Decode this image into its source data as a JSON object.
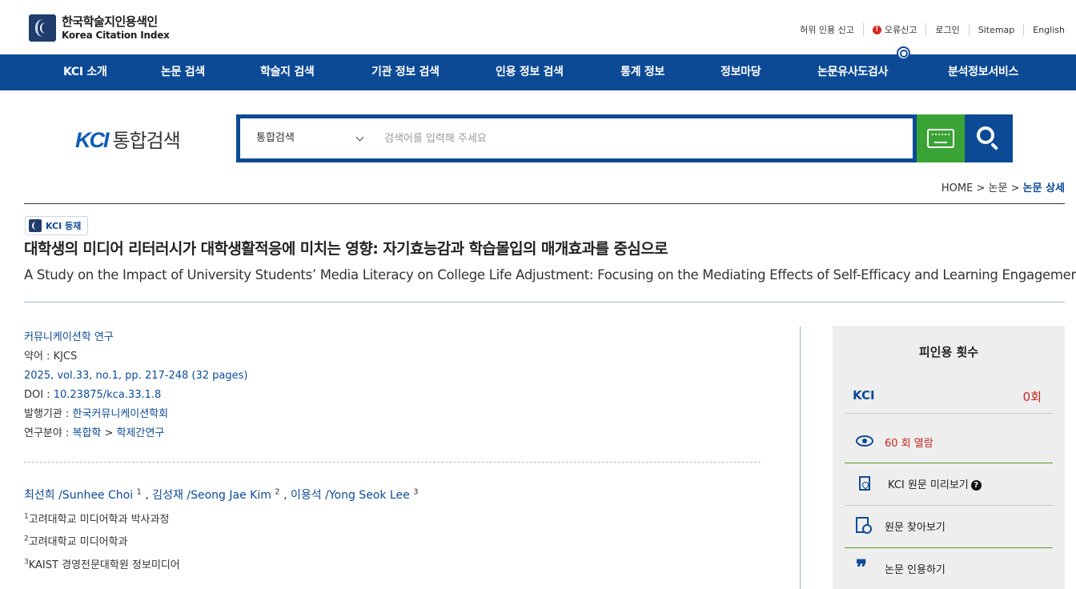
{
  "header": {
    "logo_ko": "한국학술지인용색인",
    "logo_en": "Korea Citation Index",
    "util_links": [
      "허위 인용 신고",
      "오류신고",
      "로그인",
      "Sitemap",
      "English"
    ]
  },
  "nav": {
    "items": [
      "KCI 소개",
      "논문 검색",
      "학술지 검색",
      "기관 정보 검색",
      "인용 정보 검색",
      "통계 정보",
      "정보마당",
      "논문유사도검사",
      "분석정보서비스"
    ]
  },
  "search": {
    "brand_logo": "KCI",
    "brand_text": "통합검색",
    "select_value": "통합검색",
    "placeholder": "검색어를 입력해 주세요"
  },
  "breadcrumb": {
    "home": "HOME",
    "sep1": " > ",
    "level1": "논문",
    "sep2": " > ",
    "current": "논문 상세"
  },
  "article": {
    "badge": "KCI 등재",
    "title_ko": "대학생의 미디어 리터러시가 대학생활적응에 미치는 영향: 자기효능감과 학습몰입의 매개효과를 중심으로",
    "title_en": "A Study on the Impact of University Students’ Media Literacy on College Life Adjustment: Focusing on the Mediating Effects of Self-Efficacy and Learning Engagement",
    "journal": "커뮤니케이션학 연구",
    "abbr_label": "약어 : ",
    "abbr": "KJCS",
    "volume": "2025, vol.33, no.1, pp. 217-248 (32 pages)",
    "doi_label": "DOI : ",
    "doi": "10.23875/kca.33.1.8",
    "publisher_label": "발행기관 : ",
    "publisher": "한국커뮤니케이션학회",
    "field_label": "연구분야 : ",
    "field1": "복합학",
    "field_sep": " > ",
    "field2": "학제간연구",
    "authors": [
      {
        "name": "최선희 /Sunhee Choi",
        "sup": "1"
      },
      {
        "name": "김성재 /Seong Jae Kim",
        "sup": "2"
      },
      {
        "name": "이용석 /Yong Seok Lee",
        "sup": "3"
      }
    ],
    "affiliations": [
      {
        "sup": "1",
        "text": "고려대학교 미디어학과 박사과정"
      },
      {
        "sup": "2",
        "text": "고려대학교 미디어학과"
      },
      {
        "sup": "3",
        "text": "KAIST 경영전문대학원 정보미디어"
      }
    ]
  },
  "side": {
    "title": "피인용 횟수",
    "kci_label": "KCI",
    "kci_count": "0회",
    "views": "60 회 열람",
    "preview": "KCI 원문 미리보기",
    "find_original": "원문 찾아보기",
    "cite": "논문 인용하기"
  },
  "colors": {
    "primary": "#0d4a96",
    "keyboard_button": "#3aa335",
    "accent_red": "#c8261c"
  }
}
